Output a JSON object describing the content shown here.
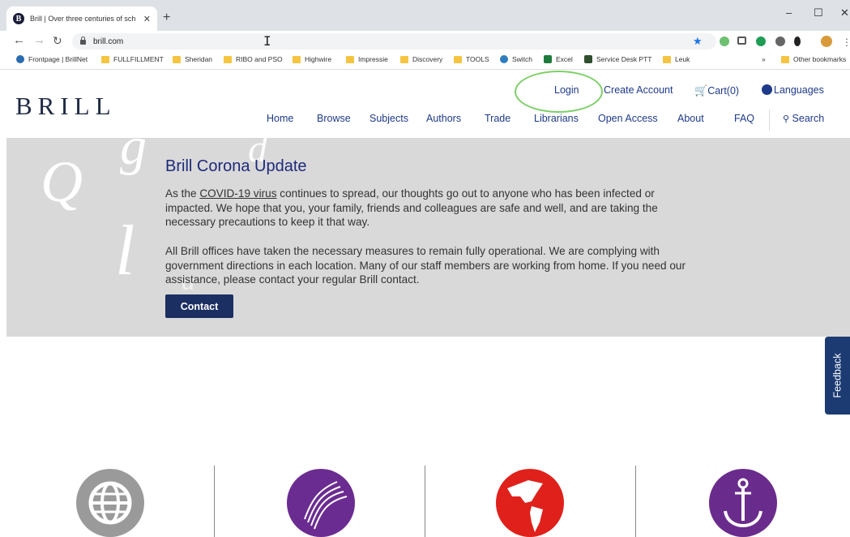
{
  "browser": {
    "tab_title": "Brill | Over three centuries of sch",
    "favicon_letter": "B",
    "tab_close": "✕",
    "new_tab": "+",
    "window_controls": [
      "–",
      "☐",
      "✕"
    ],
    "nav_icons": [
      "back-arrow-icon",
      "forward-arrow-icon",
      "reload-icon"
    ],
    "url": "brill.com",
    "bookmarks": [
      {
        "label": "Frontpage | BrillNet",
        "icon": "site-icon"
      },
      {
        "label": "FULLFILLMENT",
        "icon": "folder-icon"
      },
      {
        "label": "Sheridan",
        "icon": "folder-icon"
      },
      {
        "label": "RIBO and PSO",
        "icon": "folder-icon"
      },
      {
        "label": "Highwire",
        "icon": "folder-icon"
      },
      {
        "label": "Impressie",
        "icon": "folder-icon"
      },
      {
        "label": "Discovery",
        "icon": "folder-icon"
      },
      {
        "label": "TOOLS",
        "icon": "folder-icon"
      },
      {
        "label": "Switch",
        "icon": "site-icon"
      },
      {
        "label": "Excel",
        "icon": "excel-icon"
      },
      {
        "label": "Service Desk PTT",
        "icon": "site-icon"
      },
      {
        "label": "Leuk",
        "icon": "folder-icon"
      }
    ],
    "bookmarks_overflow": "»",
    "other_bookmarks": "Other bookmarks"
  },
  "site": {
    "logo": "BRILL",
    "util": {
      "login": "Login",
      "create_account": "Create Account",
      "cart": "Cart(0)",
      "languages": "Languages"
    },
    "nav": [
      "Home",
      "Browse",
      "Subjects",
      "Authors",
      "Trade",
      "Librarians",
      "Open Access",
      "About",
      "FAQ",
      "Search"
    ]
  },
  "banner": {
    "title": "Brill Corona Update",
    "p1_before": "As the ",
    "p1_link": "COVID-19 virus",
    "p1_after": " continues to spread, our thoughts go out to anyone who has been infected or impacted. We hope that you, your family, friends and colleagues are safe and well, and are taking the necessary precautions to keep it that way.",
    "p2": "All Brill offices have taken the necessary measures to remain fully operational. We are complying with government directions in each location. Many of our staff members are working from home. If you need our assistance, please contact your regular Brill contact.",
    "contact_button": "Contact",
    "glyphs": [
      "Q",
      "g",
      "d",
      "l",
      "a"
    ]
  },
  "feedback_label": "Feedback",
  "colors": {
    "brand_navy": "#1c2f63",
    "link_blue": "#1e3a8a",
    "banner_gray": "#d9d9d9",
    "circle_gray": "#9a9a9a",
    "circle_purple": "#6b2c91",
    "circle_red": "#e0201b",
    "circle_purple2": "#6a2c8c"
  },
  "bottom_icons": [
    "globe-icon",
    "profile-lines-icon",
    "americas-map-icon",
    "anchor-icon"
  ]
}
